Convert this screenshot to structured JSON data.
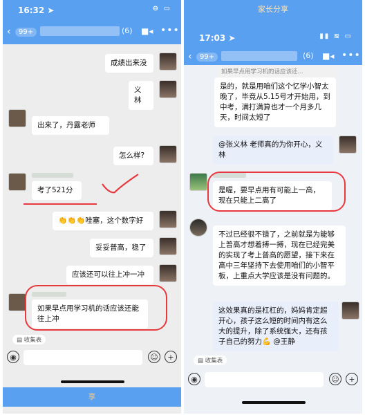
{
  "left": {
    "status_time": "16:32 ➤",
    "status_indicators": "⊖ ▭",
    "nav_badge": "99+",
    "nav_count": "(6)",
    "messages": [
      {
        "text": "成绩出来没"
      },
      {
        "text": "义林"
      },
      {
        "text": "出来了，丹露老师"
      },
      {
        "text": "怎么样?"
      },
      {
        "text": "考了521分"
      },
      {
        "text": "👏👏👏哇塞，这个数字好"
      },
      {
        "text": "妥妥普高，稳了"
      },
      {
        "text": "应该还可以往上冲一冲"
      },
      {
        "text": "如果早点用学习机的话应该还能往上冲"
      }
    ],
    "tag_label": "收集表",
    "footer_text": "享"
  },
  "right": {
    "header_title": "家长分享",
    "status_time": "17:03 ➤",
    "status_indicators": "▮▮ ≋ ▭",
    "nav_badge": "99+",
    "nav_count": "(6)",
    "quote": "如果早点用学习机的话应该还...",
    "messages": [
      {
        "text": "是的，就是用咱们这个忆学小智太晚了，毕竟从5.15号才开始用，到中考，满打满算也才一个月多几天，时间太短了"
      },
      {
        "text": "@张义林 老师真的为你开心，义林"
      },
      {
        "text": "是喔，要早点用有可能上一高，现在只能上二高了"
      },
      {
        "text": "不过已经很不错了，之前就是为能够上普高才想着搏一搏，现在已经完美的实现了考上普高的愿望，接下来在高中三年坚持下去使用咱们的小智平板，上重点大学应该是没有问题的。"
      },
      {
        "text": "这效果真的是杠杠的，妈妈肯定超开心，孩子这么短的时间内有这么大的提升，除了系统强大，还有孩子自己的努力💪 @王静"
      }
    ],
    "tag_label": "收集表"
  },
  "colors": {
    "accent": "#5aa0f0",
    "highlight": "#e8383d"
  }
}
